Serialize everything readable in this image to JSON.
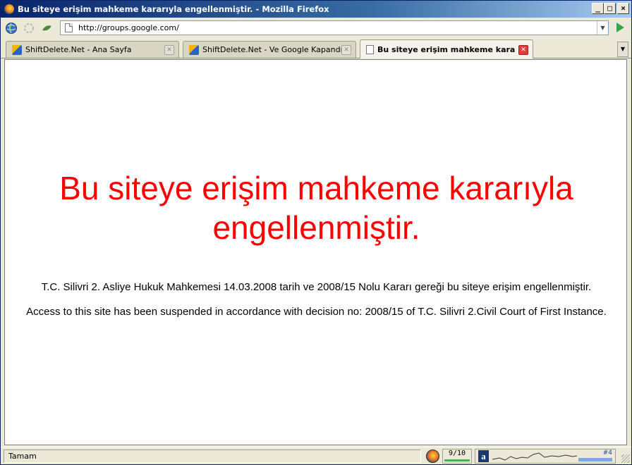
{
  "window": {
    "title": "Bu siteye erişim mahkeme kararıyla engellenmiştir. - Mozilla Firefox",
    "buttons": {
      "minimize": "_",
      "maximize": "□",
      "close": "×"
    }
  },
  "navbar": {
    "url": "http://groups.google.com/",
    "icons": [
      "globe-icon",
      "reload-icon",
      "leaf-icon"
    ]
  },
  "tabs": [
    {
      "label": "ShiftDelete.Net - Ana Sayfa",
      "active": false,
      "icon": "shiftdelete-favicon"
    },
    {
      "label": "ShiftDelete.Net - Ve Google Kapandı!",
      "active": false,
      "icon": "shiftdelete-favicon"
    },
    {
      "label": "Bu siteye erişim mahkeme kararı...",
      "active": true,
      "icon": "page-favicon"
    }
  ],
  "content": {
    "headline_line1": "Bu siteye erişim mahkeme kararıyla",
    "headline_line2": "engellenmiştir.",
    "paragraph_tr": "T.C. Silivri 2. Asliye Hukuk Mahkemesi 14.03.2008 tarih ve 2008/15 Nolu Kararı gereği bu siteye erişim engellenmiştir.",
    "paragraph_en": "Access to this site has been suspended in accordance with decision no: 2008/15 of T.C. Silivri 2.Civil Court of First Instance.",
    "headline_color": "#ff0000"
  },
  "statusbar": {
    "status_text": "Tamam",
    "counter": "9/10",
    "alexa_rank": "#4"
  }
}
